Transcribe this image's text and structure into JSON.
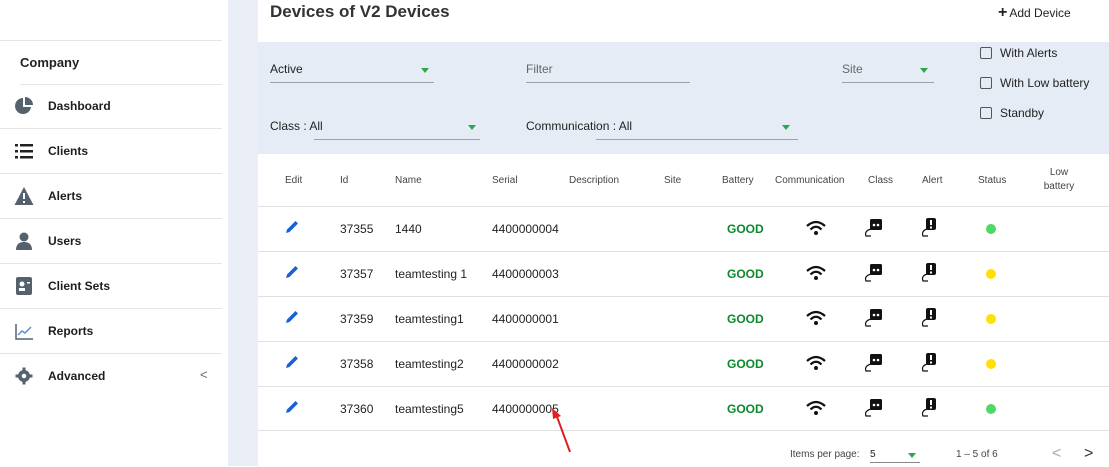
{
  "sidebar": {
    "company": "Company",
    "items": [
      {
        "label": "Dashboard",
        "icon": "pie-chart-icon"
      },
      {
        "label": "Clients",
        "icon": "list-icon"
      },
      {
        "label": "Alerts",
        "icon": "warning-icon"
      },
      {
        "label": "Users",
        "icon": "user-icon"
      },
      {
        "label": "Client Sets",
        "icon": "contact-card-icon"
      },
      {
        "label": "Reports",
        "icon": "trend-chart-icon"
      },
      {
        "label": "Advanced",
        "icon": "gear-icon",
        "chevron": "<"
      }
    ]
  },
  "header": {
    "title": "Devices of V2 Devices",
    "add_button": "Add Device",
    "add_symbol": "+"
  },
  "filters": {
    "state_value": "Active",
    "filter_placeholder": "Filter",
    "site_placeholder": "Site",
    "class_value": "Class : All",
    "communication_value": "Communication : All",
    "checkboxes": [
      "With Alerts",
      "With Low battery",
      "Standby"
    ]
  },
  "table": {
    "columns": [
      "Edit",
      "Id",
      "Name",
      "Serial",
      "Description",
      "Site",
      "Battery",
      "Communication",
      "Class",
      "Alert",
      "Status",
      "Low battery"
    ],
    "rows": [
      {
        "id": "37355",
        "name": "1440",
        "serial": "4400000004",
        "battery": "GOOD",
        "status_color": "#4cd964"
      },
      {
        "id": "37357",
        "name": "teamtesting 1",
        "serial": "4400000003",
        "battery": "GOOD",
        "status_color": "#ffe000"
      },
      {
        "id": "37359",
        "name": "teamtesting1",
        "serial": "4400000001",
        "battery": "GOOD",
        "status_color": "#ffe000"
      },
      {
        "id": "37358",
        "name": "teamtesting2",
        "serial": "4400000002",
        "battery": "GOOD",
        "status_color": "#ffe000"
      },
      {
        "id": "37360",
        "name": "teamtesting5",
        "serial": "4400000005",
        "battery": "GOOD",
        "status_color": "#4cd964"
      }
    ]
  },
  "paginator": {
    "items_per_page_label": "Items per page:",
    "page_size": "5",
    "range": "1 – 5 of 6",
    "prev": "<",
    "next": ">"
  },
  "colors": {
    "accent_blue": "#1a5fd6",
    "good_green": "#0a8a2a",
    "arrow_red": "#e02020",
    "panel_bg": "#e6ecf6"
  }
}
